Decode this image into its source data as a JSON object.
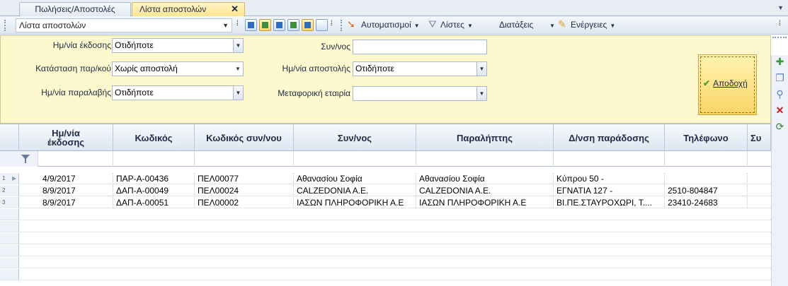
{
  "tabs": [
    {
      "label": "Πωλήσεις/Αποστολές",
      "active": false
    },
    {
      "label": "Λίστα αποστολών",
      "active": true,
      "close": "✕"
    }
  ],
  "toolbar": {
    "view_combo": "Λίστα αποστολών",
    "automations_label": "Αυτοματισμοί",
    "lists_label": "Λίστες",
    "orders_label": "Διατάξεις",
    "actions_label": "Ενέργειες"
  },
  "filters": {
    "issue_date_label": "Ημ/νία έκδοσης",
    "issue_date_value": "Οτιδήποτε",
    "order_status_label": "Κατάσταση παρ/κού",
    "order_status_value": "Χωρίς αποστολή",
    "receipt_date_label": "Ημ/νία παραλαβής",
    "receipt_date_value": "Οτιδήποτε",
    "partner_label": "Συν/νος",
    "partner_value": "",
    "send_date_label": "Ημ/νία αποστολής",
    "send_date_value": "Οτιδήποτε",
    "carrier_label": "Μεταφορική εταιρία",
    "carrier_value": "",
    "accept_label": "Αποδοχή"
  },
  "grid": {
    "columns": [
      "Ημ/νία\nέκδοσης",
      "Κωδικός",
      "Κωδικός συν/νου",
      "Συν/νος",
      "Παραλήπτης",
      "Δ/νση παράδοσης",
      "Τηλέφωνο",
      "Συ"
    ],
    "rows": [
      {
        "num": "1",
        "date": "4/9/2017",
        "code": "ΠΑΡ-Α-00436",
        "partner_code": "ΠΕΛ00077",
        "partner": "Αθανασίου Σοφία",
        "recipient": "Αθανασίου Σοφία",
        "address": "Κύπρου 50 -",
        "phone": ""
      },
      {
        "num": "2",
        "date": "8/9/2017",
        "code": "ΔΑΠ-Α-00049",
        "partner_code": "ΠΕΛ00024",
        "partner": "CALZEDONIA A.E.",
        "recipient": "CALZEDONIA A.E.",
        "address": "ΕΓΝΑΤΙΑ 127 -",
        "phone": "2510-804847"
      },
      {
        "num": "3",
        "date": "8/9/2017",
        "code": "ΔΑΠ-Α-00051",
        "partner_code": "ΠΕΛ00002",
        "partner": "ΙΑΣΩΝ ΠΛΗΡΟΦΟΡΙΚΗ Α.Ε",
        "recipient": "ΙΑΣΩΝ ΠΛΗΡΟΦΟΡΙΚΗ Α.Ε",
        "address": "ΒΙ.ΠΕ.ΣΤΑΥΡΟΧΩΡΙ, Τ....",
        "phone": "23410-24683"
      }
    ]
  },
  "icons": {
    "add": "add-icon",
    "copy": "copy-icon",
    "search": "search-icon",
    "delete": "delete-icon",
    "refresh": "refresh-icon"
  },
  "colors": {
    "filter_panel_bg": "#fdf8cd",
    "active_tab": "#fde48f",
    "accept_button": "#f9d465"
  }
}
